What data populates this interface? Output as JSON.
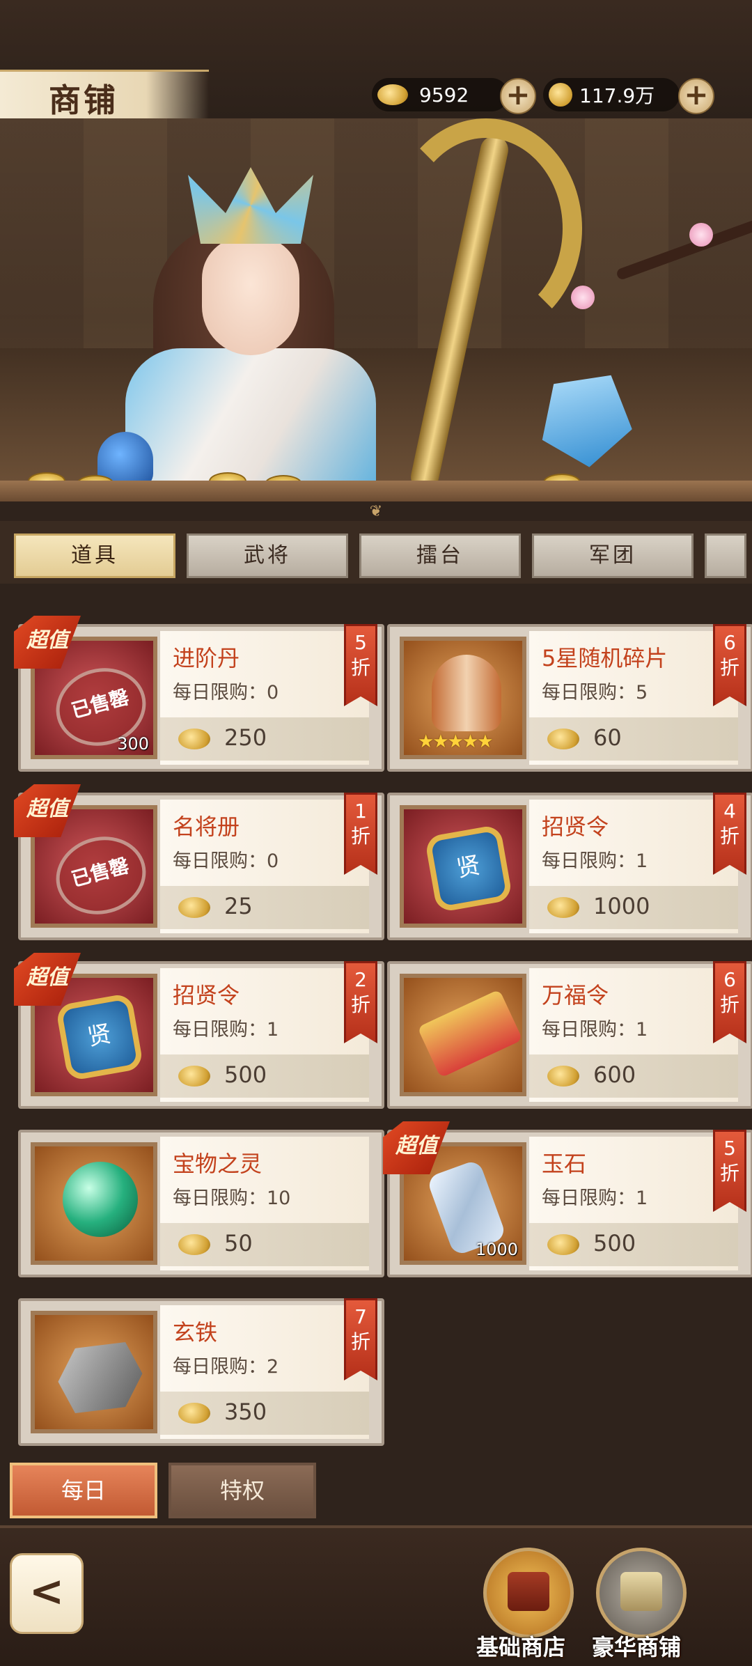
{
  "header": {
    "title": "商铺",
    "gold": "9592",
    "coins": "117.9万"
  },
  "tabs": [
    {
      "label": "道具",
      "active": true
    },
    {
      "label": "武将",
      "active": false
    },
    {
      "label": "擂台",
      "active": false
    },
    {
      "label": "军团",
      "active": false
    }
  ],
  "items": [
    {
      "name": "进阶丹",
      "limit": "每日限购：0",
      "price": "250",
      "discount": [
        "5",
        "折"
      ],
      "badge": "超值",
      "sold_out": "已售罄",
      "count": "300",
      "icon": "advance-pill-icon"
    },
    {
      "name": "5星随机碎片",
      "limit": "每日限购：5",
      "price": "60",
      "discount": [
        "6",
        "折"
      ],
      "badge": "",
      "sold_out": "",
      "count": "",
      "icon": "helmet-icon",
      "stars": "★★★★★"
    },
    {
      "name": "名将册",
      "limit": "每日限购：0",
      "price": "25",
      "discount": [
        "1",
        "折"
      ],
      "badge": "超值",
      "sold_out": "已售罄",
      "count": "",
      "icon": "book-icon"
    },
    {
      "name": "招贤令",
      "limit": "每日限购：1",
      "price": "1000",
      "discount": [
        "4",
        "折"
      ],
      "badge": "",
      "sold_out": "",
      "count": "",
      "icon": "recruit-token-icon",
      "token_char": "贤"
    },
    {
      "name": "招贤令",
      "limit": "每日限购：1",
      "price": "500",
      "discount": [
        "2",
        "折"
      ],
      "badge": "超值",
      "sold_out": "",
      "count": "",
      "icon": "recruit-token-icon",
      "token_char": "贤"
    },
    {
      "name": "万福令",
      "limit": "每日限购：1",
      "price": "600",
      "discount": [
        "6",
        "折"
      ],
      "badge": "",
      "sold_out": "",
      "count": "",
      "icon": "fortune-token-icon"
    },
    {
      "name": "宝物之灵",
      "limit": "每日限购：10",
      "price": "50",
      "discount": [],
      "badge": "",
      "sold_out": "",
      "count": "",
      "icon": "orb-icon"
    },
    {
      "name": "玉石",
      "limit": "每日限购：1",
      "price": "500",
      "discount": [
        "5",
        "折"
      ],
      "badge": "超值",
      "sold_out": "",
      "count": "1000",
      "icon": "jade-icon"
    },
    {
      "name": "玄铁",
      "limit": "每日限购：2",
      "price": "350",
      "discount": [
        "7",
        "折"
      ],
      "badge": "",
      "sold_out": "",
      "count": "",
      "icon": "iron-ore-icon"
    }
  ],
  "sub_tabs": [
    {
      "label": "每日",
      "active": true
    },
    {
      "label": "特权",
      "active": false
    }
  ],
  "bottom": {
    "back_glyph": "<",
    "basic_shop": "基础商店",
    "luxury_shop": "豪华商铺"
  }
}
